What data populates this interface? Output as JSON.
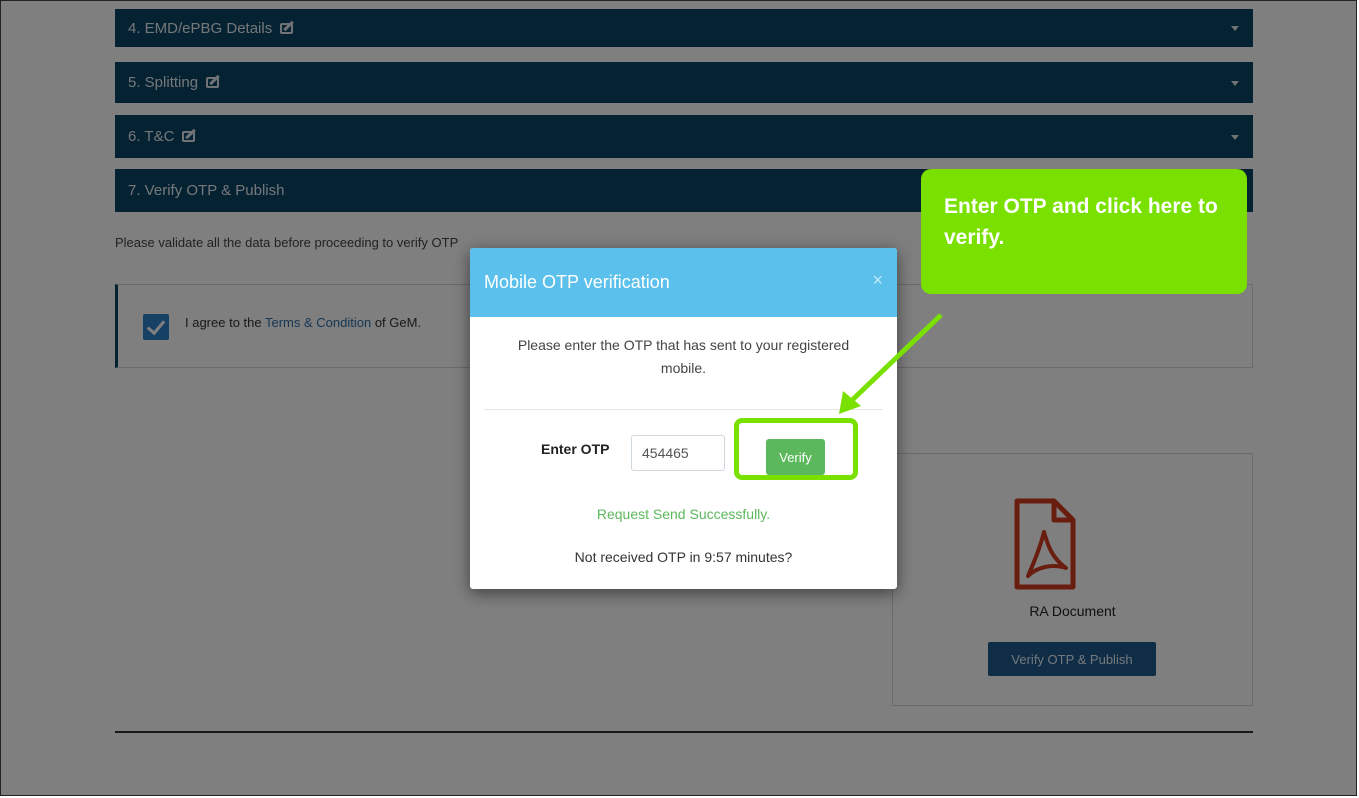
{
  "accordion": [
    {
      "label": "4. EMD/ePBG Details",
      "editable": true,
      "collapsed": true
    },
    {
      "label": "5. Splitting",
      "editable": true,
      "collapsed": true
    },
    {
      "label": "6. T&C",
      "editable": true,
      "collapsed": true
    },
    {
      "label": "7. Verify OTP & Publish",
      "editable": false,
      "collapsed": false
    }
  ],
  "validate_text": "Please validate all the data before proceeding to verify OTP",
  "agree": {
    "checked": true,
    "prefix": "I agree to the ",
    "link": "Terms & Condition",
    "suffix": " of GeM."
  },
  "document": {
    "icon": "pdf-icon",
    "label": "RA Document",
    "button": "Verify OTP & Publish"
  },
  "modal": {
    "title": "Mobile OTP verification",
    "close": "×",
    "message": "Please enter the OTP that has sent to your registered mobile.",
    "otp_label": "Enter OTP",
    "otp_value": "454465",
    "verify_button": "Verify",
    "status": "Request Send Successfully.",
    "not_received": "Not received OTP in 9:57 minutes?"
  },
  "callout": {
    "text": "Enter OTP and click here to verify.",
    "color": "#79e000"
  },
  "colors": {
    "accordion_bg": "#0b4566",
    "modal_header": "#5bc0ec",
    "verify_button": "#5cb85c",
    "publish_button": "#1f5b8e",
    "pdf_red": "#d23a1f"
  }
}
